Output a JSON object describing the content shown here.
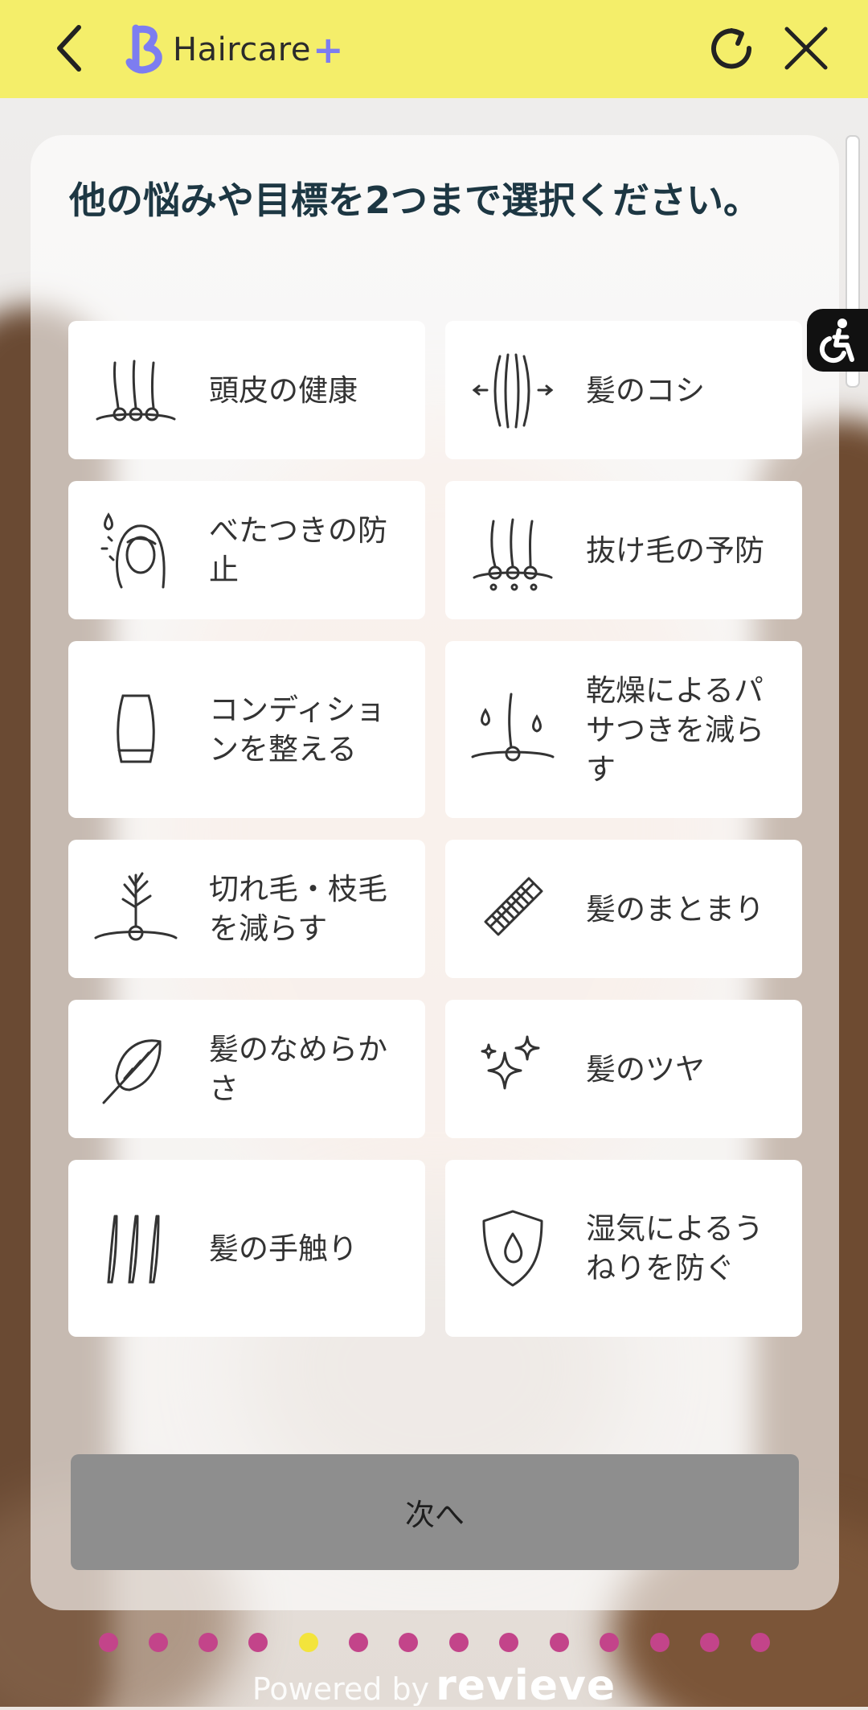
{
  "header": {
    "brand": "Haircare",
    "brand_plus": "+",
    "accent_color": "#f4ee6a",
    "logo_color": "#7d7df0",
    "back_icon": "chevron-left-icon",
    "reload_icon": "reload-icon",
    "close_icon": "close-icon"
  },
  "question": {
    "title": "他の悩みや目標を2つまで選択ください。"
  },
  "options": [
    {
      "label": "頭皮の健康",
      "icon": "hair-follicles-icon"
    },
    {
      "label": "髪のコシ",
      "icon": "hair-strength-icon"
    },
    {
      "label": "べたつきの防止",
      "icon": "oily-hair-woman-icon"
    },
    {
      "label": "抜け毛の予防",
      "icon": "hair-loss-icon"
    },
    {
      "label": "コンディションを整える",
      "icon": "conditioner-bottle-icon"
    },
    {
      "label": "乾燥によるパサつきを減らす",
      "icon": "dry-hair-droplets-icon"
    },
    {
      "label": "切れ毛・枝毛を減らす",
      "icon": "split-ends-icon"
    },
    {
      "label": "髪のまとまり",
      "icon": "comb-icon"
    },
    {
      "label": "髪のなめらかさ",
      "icon": "feather-icon"
    },
    {
      "label": "髪のツヤ",
      "icon": "sparkles-icon"
    },
    {
      "label": "髪の手触り",
      "icon": "hair-strands-icon"
    },
    {
      "label": "湿気によるうねりを防ぐ",
      "icon": "shield-droplet-icon"
    }
  ],
  "next_button": {
    "label": "次へ",
    "color": "#8e8e8e"
  },
  "accessibility_icon": "accessibility-icon",
  "progress": {
    "total": 14,
    "current": 5,
    "dot_color": "#c3448a",
    "active_color": "#f3e43c"
  },
  "footer": {
    "powered_by": "Powered by",
    "brand": "revieve"
  }
}
